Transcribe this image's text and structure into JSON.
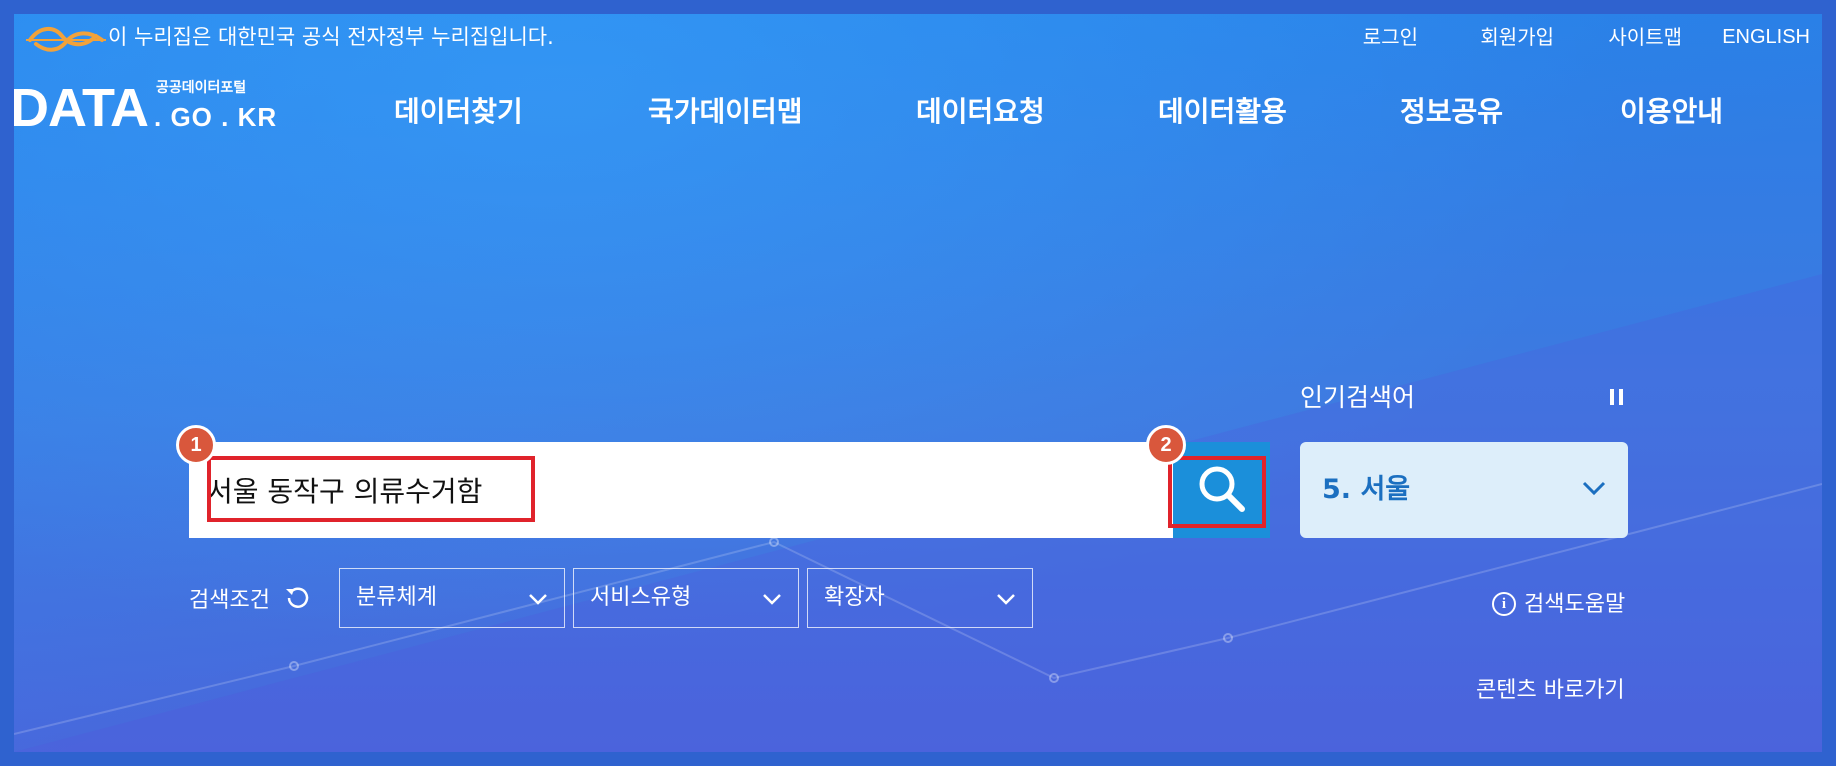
{
  "gov_banner": {
    "logo_icon": "gov-eg-logo-icon",
    "notice": "이 누리집은 대한민국 공식 전자정부 누리집입니다."
  },
  "utility_links": {
    "login": "로그인",
    "join": "회원가입",
    "sitemap": "사이트맵",
    "english": "ENGLISH"
  },
  "logo": {
    "main": "DATA",
    "sub": "공공데이터포털",
    "domain": ". GO . KR"
  },
  "nav": [
    {
      "label": "데이터찾기"
    },
    {
      "label": "국가데이터맵"
    },
    {
      "label": "데이터요청"
    },
    {
      "label": "데이터활용"
    },
    {
      "label": "정보공유"
    },
    {
      "label": "이용안내"
    }
  ],
  "search": {
    "value": "서울 동작구 의류수거함",
    "button_icon": "search-icon"
  },
  "annotations": {
    "step1": "1",
    "step2": "2",
    "highlight_color": "#e0232b",
    "badge_color": "#d9573c"
  },
  "popular": {
    "label": "인기검색어",
    "current": "5. 서울",
    "pause_icon": "pause-icon"
  },
  "filters": {
    "label": "검색조건",
    "reset_icon": "reset-icon",
    "items": [
      {
        "label": "분류체계"
      },
      {
        "label": "서비스유형"
      },
      {
        "label": "확장자"
      }
    ]
  },
  "help": {
    "label": "검색도움말",
    "icon_text": "i"
  },
  "shortcut": {
    "label": "콘텐츠 바로가기"
  },
  "colors": {
    "accent": "#1b8fda",
    "popular_text": "#1b6fc0"
  }
}
